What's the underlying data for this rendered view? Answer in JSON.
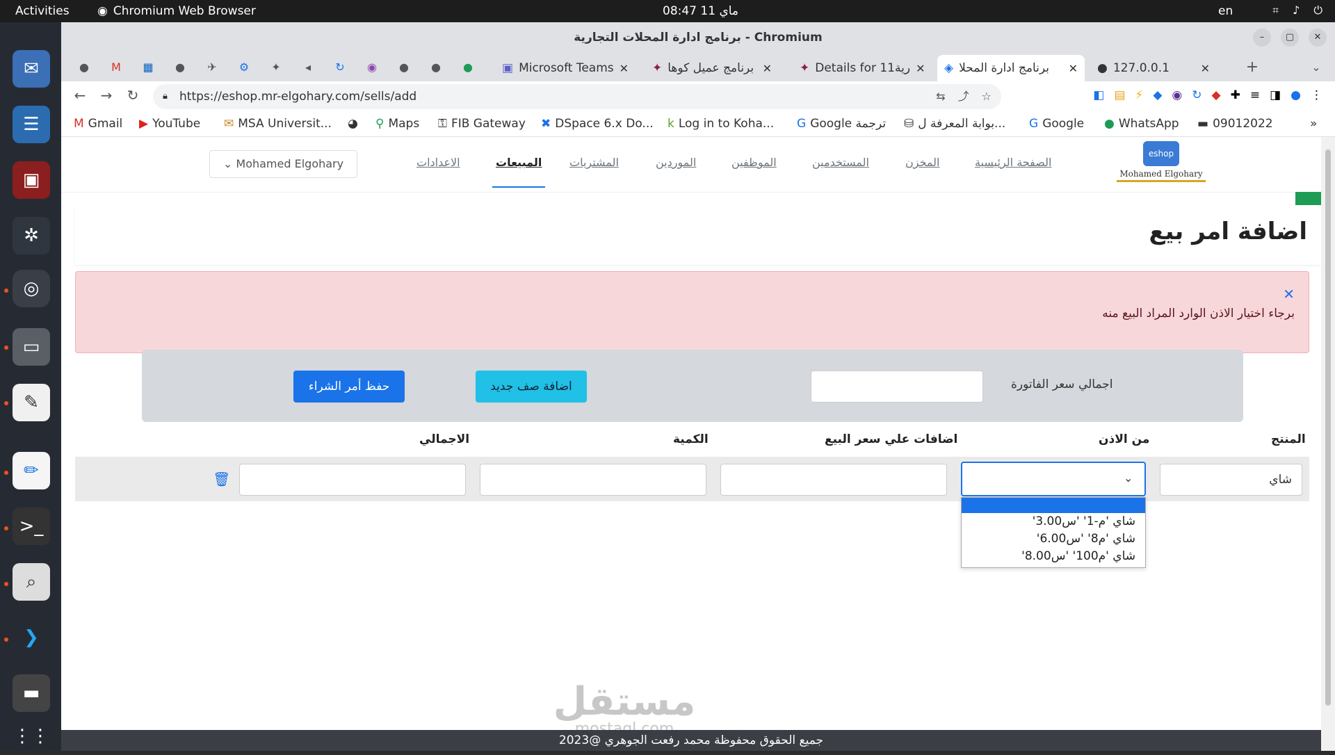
{
  "system_bar": {
    "activities": "Activities",
    "app_name": "Chromium Web Browser",
    "clock": "ماي 11  08:47",
    "lang": "en"
  },
  "window": {
    "title": "برنامج ادارة المحلات التجارية - Chromium"
  },
  "tabs": [
    {
      "label": "Microsoft Teams"
    },
    {
      "label": "برنامج عميل كوها"
    },
    {
      "label": "Details for 11رية"
    },
    {
      "label": "برنامج ادارة المحلا"
    },
    {
      "label": "127.0.0.1"
    }
  ],
  "address_bar": {
    "url": "https://eshop.mr-elgohary.com/sells/add"
  },
  "bookmarks": [
    {
      "label": "Gmail"
    },
    {
      "label": "YouTube"
    },
    {
      "label": "MSA Universit..."
    },
    {
      "label": "Maps"
    },
    {
      "label": "FIB Gateway"
    },
    {
      "label": "DSpace 6.x Do..."
    },
    {
      "label": "Log in to Koha..."
    },
    {
      "label": "Google ترجمة"
    },
    {
      "label": "بوابة المعرفة ل..."
    },
    {
      "label": "Google"
    },
    {
      "label": "WhatsApp"
    },
    {
      "label": "09012022"
    }
  ],
  "site": {
    "logo_badge": "eshop",
    "logo_name": "Mohamed Elgohary",
    "nav": [
      {
        "label": "الصفحة الرئيسية"
      },
      {
        "label": "المخزن"
      },
      {
        "label": "المستخدمين"
      },
      {
        "label": "الموظفين"
      },
      {
        "label": "الموردين"
      },
      {
        "label": "المشتريات"
      },
      {
        "label": "المبيعات"
      },
      {
        "label": "الاعدادات"
      }
    ],
    "user_menu": "Mohamed Elgohary"
  },
  "page": {
    "title": "اضافة امر بيع",
    "alert_message": "برجاء اختيار الاذن الوارد المراد البيع منه",
    "invoice_total_label": "اجمالي سعر الفاتورة",
    "add_row_button": "اضافة صف جديد",
    "save_button": "حفظ أمر الشراء",
    "columns": {
      "product": "المنتج",
      "from_permit": "من الاذن",
      "price_additions": "اضافات علي سعر البيع",
      "quantity": "الكمية",
      "total": "الاجمالي"
    },
    "row": {
      "product_value": "شاي"
    },
    "dropdown_options": [
      "شاي 'م-1' 'س3.00'",
      "شاي 'م8' 'س6.00'",
      "شاي 'م100' 'س8.00'"
    ],
    "watermark_main": "مستقل",
    "watermark_sub": "mostaql.com",
    "footer": "جميع الحقوق محفوظة محمد رفعت الجوهري @2023"
  }
}
